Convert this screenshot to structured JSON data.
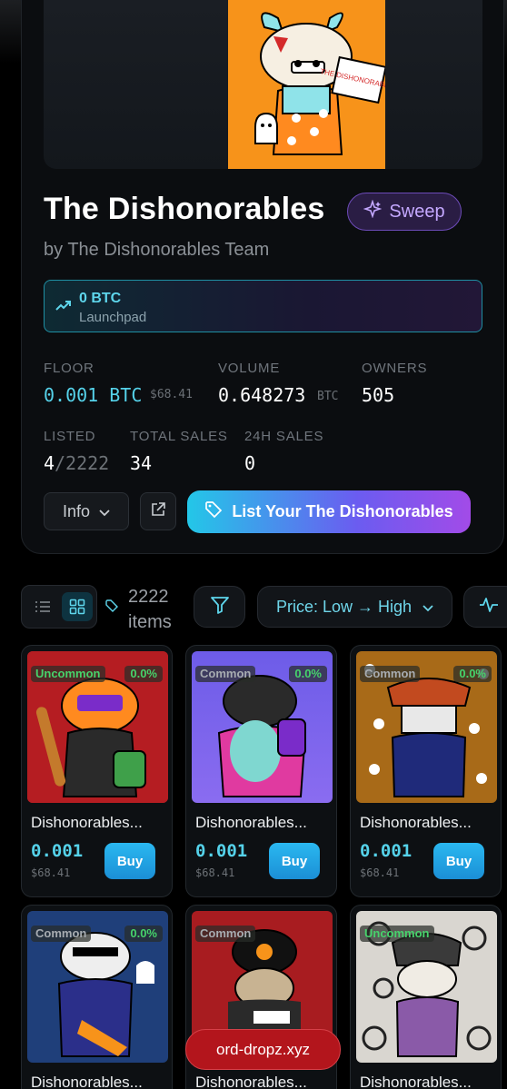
{
  "collection": {
    "title": "The Dishonorables",
    "byline": "by The Dishonorables Team",
    "sweep_label": "Sweep",
    "launchpad": {
      "amount": "0 BTC",
      "label": "Launchpad"
    },
    "cover_sign_text": "THE DISHONORABLES"
  },
  "stats": {
    "floor_label": "FLOOR",
    "floor_value": "0.001 BTC",
    "floor_usd": "$68.41",
    "volume_label": "VOLUME",
    "volume_value": "0.648273",
    "volume_unit": "BTC",
    "owners_label": "OWNERS",
    "owners_value": "505",
    "listed_label": "LISTED",
    "listed_value": "4",
    "listed_total": "/2222",
    "total_sales_label": "TOTAL SALES",
    "total_sales_value": "34",
    "sales24_label": "24H SALES",
    "sales24_value": "0"
  },
  "actions": {
    "info_label": "Info",
    "list_label": "List Your The Dishonorables"
  },
  "toolbar": {
    "count": "2222",
    "count_unit": "items",
    "sort_label": "Price: Low → High"
  },
  "items": [
    {
      "rarity": "Uncommon",
      "rarity_color": "#46d36b",
      "pct": "0.0%",
      "name": "Dishonorables...",
      "price": "0.001",
      "usd": "$68.41",
      "buy": "Buy",
      "bg": "#b51d22"
    },
    {
      "rarity": "Common",
      "rarity_color": "#a7acb1",
      "pct": "0.0%",
      "name": "Dishonorables...",
      "price": "0.001",
      "usd": "$68.41",
      "buy": "Buy",
      "bg": "#7b5ce8"
    },
    {
      "rarity": "Common",
      "rarity_color": "#a7acb1",
      "pct": "0.0%",
      "name": "Dishonorables...",
      "price": "0.001",
      "usd": "$68.41",
      "buy": "Buy",
      "bg": "#a86a18"
    },
    {
      "rarity": "Common",
      "rarity_color": "#a7acb1",
      "pct": "0.0%",
      "name": "Dishonorables...",
      "bg": "#1f3f7a"
    },
    {
      "rarity": "Common",
      "rarity_color": "#a7acb1",
      "name": "Dishonorables...",
      "bg": "#a81c20"
    },
    {
      "rarity": "Uncommon",
      "rarity_color": "#46d36b",
      "name": "Dishonorables...",
      "bg": "#d9d6d0"
    }
  ],
  "watermark": "ord-dropz.xyz",
  "colors": {
    "accent": "#55d2ea",
    "purple": "#a24be8",
    "background": "#000000"
  }
}
